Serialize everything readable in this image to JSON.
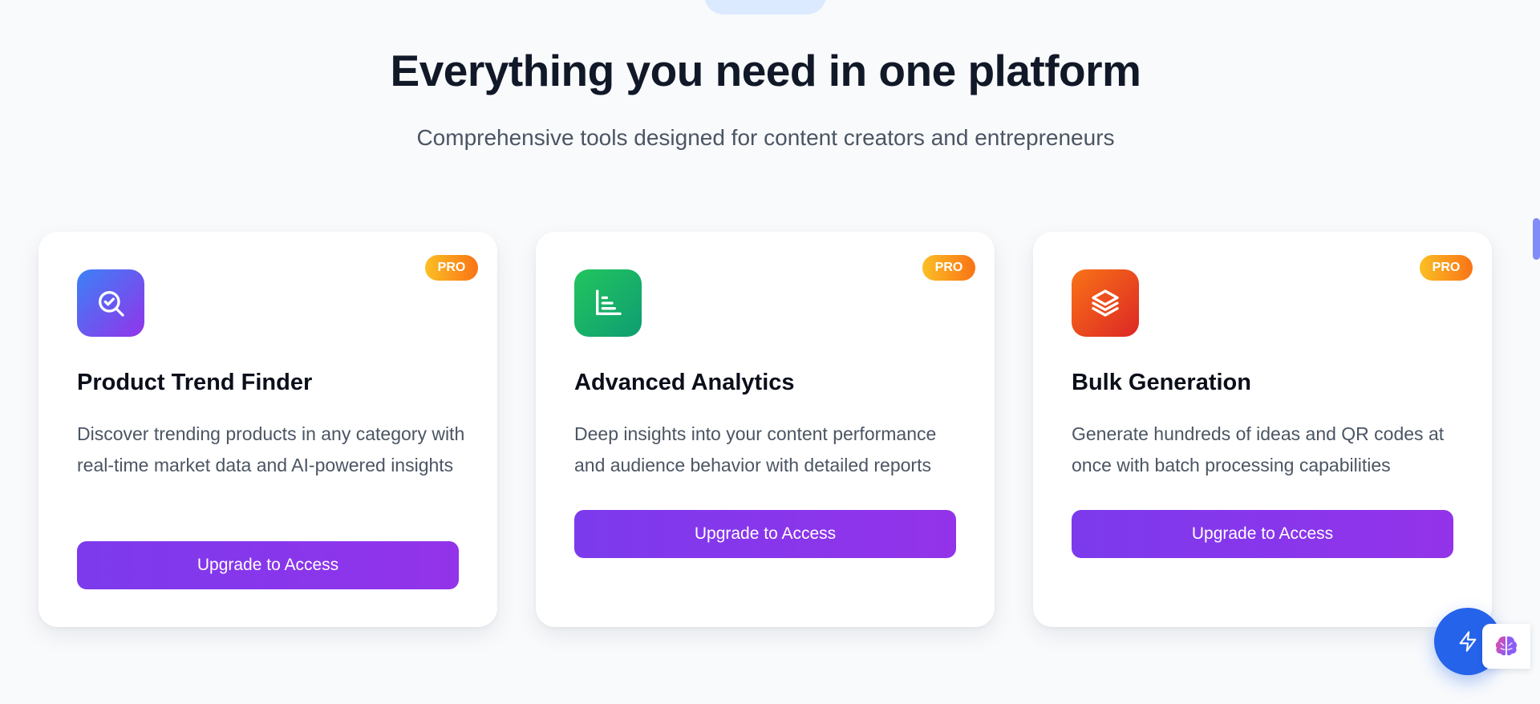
{
  "hero": {
    "title": "Everything you need in one platform",
    "subtitle": "Comprehensive tools designed for content creators and entrepreneurs"
  },
  "cards": [
    {
      "badge": "PRO",
      "icon": "search-check-icon",
      "title": "Product Trend Finder",
      "description": "Discover trending products in any category with real-time market data and AI-powered insights",
      "button": "Upgrade to Access"
    },
    {
      "badge": "PRO",
      "icon": "bar-chart-icon",
      "title": "Advanced Analytics",
      "description": "Deep insights into your content performance and audience behavior with detailed reports",
      "button": "Upgrade to Access"
    },
    {
      "badge": "PRO",
      "icon": "layers-icon",
      "title": "Bulk Generation",
      "description": "Generate hundreds of ideas and QR codes at once with batch processing capabilities",
      "button": "Upgrade to Access"
    }
  ],
  "floating": {
    "fab_icon": "lightning-icon",
    "assistant_icon": "brain-icon"
  },
  "colors": {
    "accent": "#7c3aed",
    "fab": "#2563eb",
    "badge": "#f59e0b"
  }
}
